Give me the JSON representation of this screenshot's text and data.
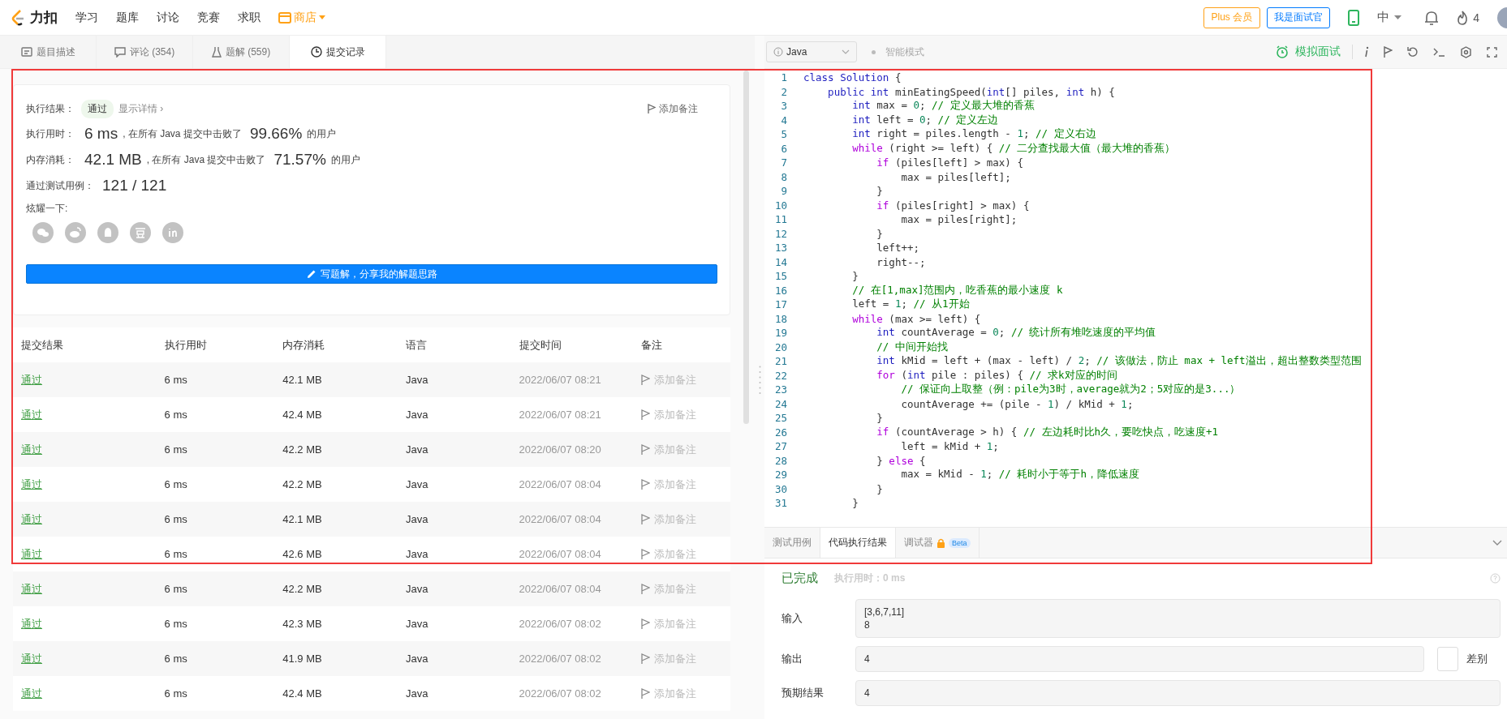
{
  "nav": {
    "logo": "力扣",
    "items": [
      {
        "label": "学习"
      },
      {
        "label": "题库"
      },
      {
        "label": "讨论"
      },
      {
        "label": "竞赛"
      },
      {
        "label": "求职"
      }
    ],
    "shop": "商店",
    "plus": "Plus 会员",
    "interviewer": "我是面试官",
    "language": "中",
    "points": "4"
  },
  "left_tabs": [
    {
      "label": "题目描述",
      "kind": "desc",
      "selected": false
    },
    {
      "label": "评论 (354)",
      "kind": "comment",
      "selected": false
    },
    {
      "label": "题解 (559)",
      "kind": "flask",
      "selected": false
    },
    {
      "label": "提交记录",
      "kind": "clock",
      "selected": true
    }
  ],
  "result": {
    "label": "执行结果：",
    "status": "通过",
    "details": "显示详情 ›",
    "note": "添加备注",
    "stats": [
      {
        "label": "执行用时：",
        "value": "6 ms",
        "middle": ", 在所有 Java 提交中击败了",
        "percent": "99.66%",
        "tail": "的用户"
      },
      {
        "label": "内存消耗：",
        "value": "42.1 MB",
        "middle": ", 在所有 Java 提交中击败了",
        "percent": "71.57%",
        "tail": "的用户"
      }
    ],
    "cases_label": "通过测试用例：",
    "cases": "121 / 121",
    "share_label": "炫耀一下:",
    "share": [
      {
        "kind": "chat"
      },
      {
        "kind": "swirl"
      },
      {
        "kind": "penguin"
      },
      {
        "kind": "bean"
      },
      {
        "kind": "in"
      }
    ],
    "write_button": "写题解，分享我的解题思路"
  },
  "table": {
    "columns": [
      "提交结果",
      "执行用时",
      "内存消耗",
      "语言",
      "提交时间",
      "备注"
    ],
    "rows": [
      {
        "result": "通过",
        "time": "6 ms",
        "memory": "42.1 MB",
        "lang": "Java",
        "submitted": "2022/06/07 08:21",
        "note": "添加备注"
      },
      {
        "result": "通过",
        "time": "6 ms",
        "memory": "42.4 MB",
        "lang": "Java",
        "submitted": "2022/06/07 08:21",
        "note": "添加备注"
      },
      {
        "result": "通过",
        "time": "6 ms",
        "memory": "42.2 MB",
        "lang": "Java",
        "submitted": "2022/06/07 08:20",
        "note": "添加备注"
      },
      {
        "result": "通过",
        "time": "6 ms",
        "memory": "42.2 MB",
        "lang": "Java",
        "submitted": "2022/06/07 08:04",
        "note": "添加备注"
      },
      {
        "result": "通过",
        "time": "6 ms",
        "memory": "42.1 MB",
        "lang": "Java",
        "submitted": "2022/06/07 08:04",
        "note": "添加备注"
      },
      {
        "result": "通过",
        "time": "6 ms",
        "memory": "42.6 MB",
        "lang": "Java",
        "submitted": "2022/06/07 08:04",
        "note": "添加备注"
      },
      {
        "result": "通过",
        "time": "6 ms",
        "memory": "42.2 MB",
        "lang": "Java",
        "submitted": "2022/06/07 08:04",
        "note": "添加备注"
      },
      {
        "result": "通过",
        "time": "6 ms",
        "memory": "42.3 MB",
        "lang": "Java",
        "submitted": "2022/06/07 08:02",
        "note": "添加备注"
      },
      {
        "result": "通过",
        "time": "6 ms",
        "memory": "41.9 MB",
        "lang": "Java",
        "submitted": "2022/06/07 08:02",
        "note": "添加备注"
      },
      {
        "result": "通过",
        "time": "6 ms",
        "memory": "42.4 MB",
        "lang": "Java",
        "submitted": "2022/06/07 08:02",
        "note": "添加备注"
      }
    ]
  },
  "editor": {
    "language": "Java",
    "mode": "智能模式",
    "mock": "模拟面试",
    "lines": [
      {
        "no": "1",
        "tokens": [
          {
            "kind": "k",
            "text": "class Solution"
          },
          {
            "kind": "p",
            "text": " {"
          }
        ]
      },
      {
        "no": "2",
        "tokens": [
          {
            "kind": "k",
            "text": "    public int"
          },
          {
            "kind": "p",
            "text": " minEatingSpeed("
          },
          {
            "kind": "k",
            "text": "int"
          },
          {
            "kind": "p",
            "text": "[] piles, "
          },
          {
            "kind": "k",
            "text": "int"
          },
          {
            "kind": "p",
            "text": " h) {"
          }
        ]
      },
      {
        "no": "3",
        "tokens": [
          {
            "kind": "k",
            "text": "        int"
          },
          {
            "kind": "p",
            "text": " max = "
          },
          {
            "kind": "n",
            "text": "0"
          },
          {
            "kind": "p",
            "text": "; "
          },
          {
            "kind": "m",
            "text": "// 定义最大堆的香蕉"
          }
        ]
      },
      {
        "no": "4",
        "tokens": [
          {
            "kind": "k",
            "text": "        int"
          },
          {
            "kind": "p",
            "text": " left = "
          },
          {
            "kind": "n",
            "text": "0"
          },
          {
            "kind": "p",
            "text": "; "
          },
          {
            "kind": "m",
            "text": "// 定义左边"
          }
        ]
      },
      {
        "no": "5",
        "tokens": [
          {
            "kind": "k",
            "text": "        int"
          },
          {
            "kind": "p",
            "text": " right = piles.length - "
          },
          {
            "kind": "n",
            "text": "1"
          },
          {
            "kind": "p",
            "text": "; "
          },
          {
            "kind": "m",
            "text": "// 定义右边"
          }
        ]
      },
      {
        "no": "6",
        "tokens": [
          {
            "kind": "c",
            "text": "        while"
          },
          {
            "kind": "p",
            "text": " (right >= left) { "
          },
          {
            "kind": "m",
            "text": "// 二分查找最大值（最大堆的香蕉）"
          }
        ]
      },
      {
        "no": "7",
        "tokens": [
          {
            "kind": "c",
            "text": "            if"
          },
          {
            "kind": "p",
            "text": " (piles[left] > max) {"
          }
        ]
      },
      {
        "no": "8",
        "tokens": [
          {
            "kind": "p",
            "text": "                max = piles[left];"
          }
        ]
      },
      {
        "no": "9",
        "tokens": [
          {
            "kind": "p",
            "text": "            }"
          }
        ]
      },
      {
        "no": "10",
        "tokens": [
          {
            "kind": "c",
            "text": "            if"
          },
          {
            "kind": "p",
            "text": " (piles[right] > max) {"
          }
        ]
      },
      {
        "no": "11",
        "tokens": [
          {
            "kind": "p",
            "text": "                max = piles[right];"
          }
        ]
      },
      {
        "no": "12",
        "tokens": [
          {
            "kind": "p",
            "text": "            }"
          }
        ]
      },
      {
        "no": "13",
        "tokens": [
          {
            "kind": "p",
            "text": "            left++;"
          }
        ]
      },
      {
        "no": "14",
        "tokens": [
          {
            "kind": "p",
            "text": "            right--;"
          }
        ]
      },
      {
        "no": "15",
        "tokens": [
          {
            "kind": "p",
            "text": "        }"
          }
        ]
      },
      {
        "no": "16",
        "tokens": [
          {
            "kind": "m",
            "text": "        // 在[1,max]范围内，吃香蕉的最小速度 k"
          }
        ]
      },
      {
        "no": "17",
        "tokens": [
          {
            "kind": "p",
            "text": "        left = "
          },
          {
            "kind": "n",
            "text": "1"
          },
          {
            "kind": "p",
            "text": "; "
          },
          {
            "kind": "m",
            "text": "// 从1开始"
          }
        ]
      },
      {
        "no": "18",
        "tokens": [
          {
            "kind": "c",
            "text": "        while"
          },
          {
            "kind": "p",
            "text": " (max >= left) {"
          }
        ]
      },
      {
        "no": "19",
        "tokens": [
          {
            "kind": "k",
            "text": "            int"
          },
          {
            "kind": "p",
            "text": " countAverage = "
          },
          {
            "kind": "n",
            "text": "0"
          },
          {
            "kind": "p",
            "text": "; "
          },
          {
            "kind": "m",
            "text": "// 统计所有堆吃速度的平均值"
          }
        ]
      },
      {
        "no": "20",
        "tokens": [
          {
            "kind": "m",
            "text": "            // 中间开始找"
          }
        ]
      },
      {
        "no": "21",
        "tokens": [
          {
            "kind": "k",
            "text": "            int"
          },
          {
            "kind": "p",
            "text": " kMid = left + (max - left) / "
          },
          {
            "kind": "n",
            "text": "2"
          },
          {
            "kind": "p",
            "text": "; "
          },
          {
            "kind": "m",
            "text": "// 该做法，防止 max + left溢出，超出整数类型范围"
          }
        ]
      },
      {
        "no": "22",
        "tokens": [
          {
            "kind": "c",
            "text": "            for"
          },
          {
            "kind": "p",
            "text": " ("
          },
          {
            "kind": "k",
            "text": "int"
          },
          {
            "kind": "p",
            "text": " pile : piles) { "
          },
          {
            "kind": "m",
            "text": "// 求k对应的时间"
          }
        ]
      },
      {
        "no": "23",
        "tokens": [
          {
            "kind": "m",
            "text": "                // 保证向上取整（例：pile为3时，average就为2；5对应的是3...）"
          }
        ]
      },
      {
        "no": "24",
        "tokens": [
          {
            "kind": "p",
            "text": "                countAverage += (pile - "
          },
          {
            "kind": "n",
            "text": "1"
          },
          {
            "kind": "p",
            "text": ") / kMid + "
          },
          {
            "kind": "n",
            "text": "1"
          },
          {
            "kind": "p",
            "text": ";"
          }
        ]
      },
      {
        "no": "25",
        "tokens": [
          {
            "kind": "p",
            "text": "            }"
          }
        ]
      },
      {
        "no": "26",
        "tokens": [
          {
            "kind": "c",
            "text": "            if"
          },
          {
            "kind": "p",
            "text": " (countAverage > h) { "
          },
          {
            "kind": "m",
            "text": "// 左边耗时比h久，要吃快点，吃速度+1"
          }
        ]
      },
      {
        "no": "27",
        "tokens": [
          {
            "kind": "p",
            "text": "                left = kMid + "
          },
          {
            "kind": "n",
            "text": "1"
          },
          {
            "kind": "p",
            "text": ";"
          }
        ]
      },
      {
        "no": "28",
        "tokens": [
          {
            "kind": "p",
            "text": "            } "
          },
          {
            "kind": "c",
            "text": "else"
          },
          {
            "kind": "p",
            "text": " {"
          }
        ]
      },
      {
        "no": "29",
        "tokens": [
          {
            "kind": "p",
            "text": "                max = kMid - "
          },
          {
            "kind": "n",
            "text": "1"
          },
          {
            "kind": "p",
            "text": "; "
          },
          {
            "kind": "m",
            "text": "// 耗时小于等于h，降低速度"
          }
        ]
      },
      {
        "no": "30",
        "tokens": [
          {
            "kind": "p",
            "text": "            }"
          }
        ]
      },
      {
        "no": "31",
        "tokens": [
          {
            "kind": "p",
            "text": "        }"
          }
        ]
      }
    ]
  },
  "console": {
    "tabs": [
      {
        "label": "测试用例",
        "selected": false,
        "locked": false
      },
      {
        "label": "代码执行结果",
        "selected": true,
        "locked": false
      },
      {
        "label": "调试器",
        "selected": false,
        "locked": true,
        "badge": "Beta"
      }
    ],
    "status": "已完成",
    "runtime": "执行用时：0 ms",
    "fields": [
      {
        "label": "输入",
        "lines": [
          "[3,6,7,11]",
          "8"
        ]
      },
      {
        "label": "输出",
        "lines": [
          "4"
        ]
      },
      {
        "label": "预期结果",
        "lines": [
          "4"
        ]
      }
    ],
    "diff": {
      "label": "差别",
      "on": false
    }
  }
}
